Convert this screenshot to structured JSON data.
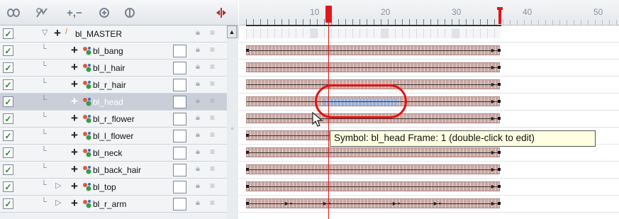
{
  "toolbar": {
    "icons": [
      "animate-icon",
      "onion-skin-icon",
      "add-remove-icon",
      "layer-props-icon",
      "peg-icon"
    ],
    "add_remove_label": "+,−",
    "sync_icon": "expand-icon"
  },
  "ruler": {
    "labels": [
      "10",
      "20",
      "30",
      "40",
      "50"
    ]
  },
  "layers": [
    {
      "name": "bl_MASTER",
      "checked": true,
      "type": "master",
      "selected": false
    },
    {
      "name": "bl_bang",
      "checked": true,
      "type": "symbol",
      "selected": false
    },
    {
      "name": "bl_l_hair",
      "checked": true,
      "type": "symbol",
      "selected": false
    },
    {
      "name": "bl_r_hair",
      "checked": true,
      "type": "symbol",
      "selected": false
    },
    {
      "name": "bl_head",
      "checked": true,
      "type": "symbol",
      "selected": true
    },
    {
      "name": "bl_r_flower",
      "checked": true,
      "type": "symbol",
      "selected": false
    },
    {
      "name": "bl_l_flower",
      "checked": true,
      "type": "symbol",
      "selected": false
    },
    {
      "name": "bl_neck",
      "checked": true,
      "type": "symbol",
      "selected": false
    },
    {
      "name": "bl_back_hair",
      "checked": true,
      "type": "symbol",
      "selected": false
    },
    {
      "name": "bl_top",
      "checked": true,
      "type": "symbol",
      "selected": false
    },
    {
      "name": "bl_r_arm",
      "checked": true,
      "type": "symbol",
      "selected": false
    }
  ],
  "tooltip": {
    "text": "Symbol: bl_head Frame: 1 (double-click to edit)"
  },
  "colors": {
    "playhead": "#e0181a",
    "frame_fill": "#c8a6a2",
    "selection_fill": "#9bb0d8",
    "highlight_circle": "#e81010",
    "tooltip_bg": "#ffffe1"
  }
}
